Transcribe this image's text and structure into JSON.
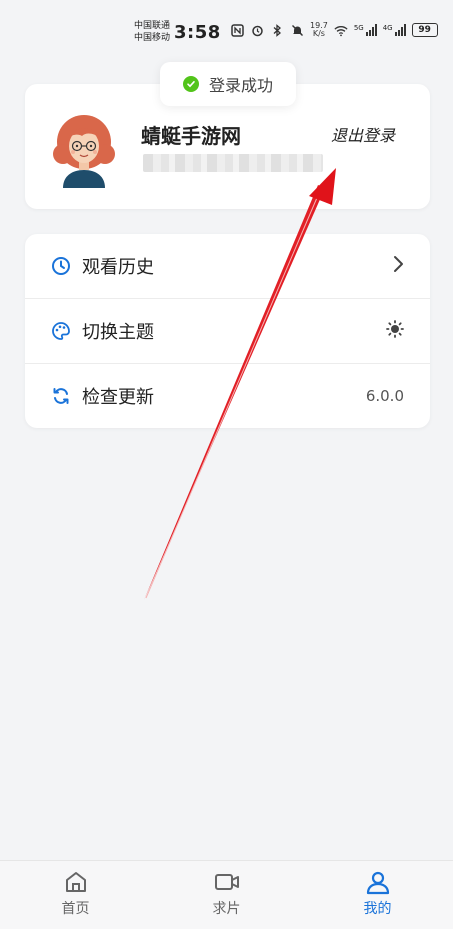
{
  "statusbar": {
    "carrier_1": "中国联通",
    "carrier_2": "中国移动",
    "time": "3:58",
    "net_speed_value": "19.7",
    "net_speed_unit": "K/s",
    "signal_1_label": "5G",
    "signal_2_label": "4G",
    "battery": "99"
  },
  "toast": {
    "message": "登录成功",
    "icon": "check-circle-icon",
    "color": "#52c41a"
  },
  "profile": {
    "username": "蜻蜓手游网",
    "logout_label": "退出登录",
    "avatar": "avatar-illustration"
  },
  "menu": {
    "items": [
      {
        "label": "观看历史",
        "icon": "clock-icon",
        "right": "chevron-right-icon"
      },
      {
        "label": "切换主题",
        "icon": "palette-icon",
        "right": "sun-icon"
      },
      {
        "label": "检查更新",
        "icon": "refresh-icon",
        "right_text": "6.0.0"
      }
    ]
  },
  "tabs": [
    {
      "label": "首页",
      "icon": "home-icon",
      "active": false
    },
    {
      "label": "求片",
      "icon": "video-camera-icon",
      "active": false
    },
    {
      "label": "我的",
      "icon": "user-icon",
      "active": true
    }
  ],
  "colors": {
    "accent": "#1a73d9",
    "background": "#f3f4f6",
    "annotation_arrow": "#e0131a"
  }
}
